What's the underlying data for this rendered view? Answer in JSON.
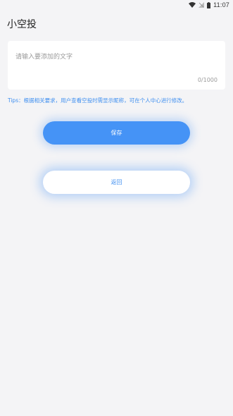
{
  "status_bar": {
    "time": "11:07",
    "icons": [
      "wifi-icon",
      "signal-icon",
      "battery-icon"
    ]
  },
  "header": {
    "title": "小空投"
  },
  "input": {
    "placeholder": "请输入要添加的文字",
    "value": "",
    "char_count": "0/1000"
  },
  "tips": "Tips：根据相关要求，用户查看空投时需显示昵称，可在个人中心进行修改。",
  "buttons": {
    "save_label": "保存",
    "back_label": "返回"
  },
  "colors": {
    "accent": "#4593f6",
    "background": "#f4f4f6",
    "tips_text": "#3f8ff0"
  }
}
